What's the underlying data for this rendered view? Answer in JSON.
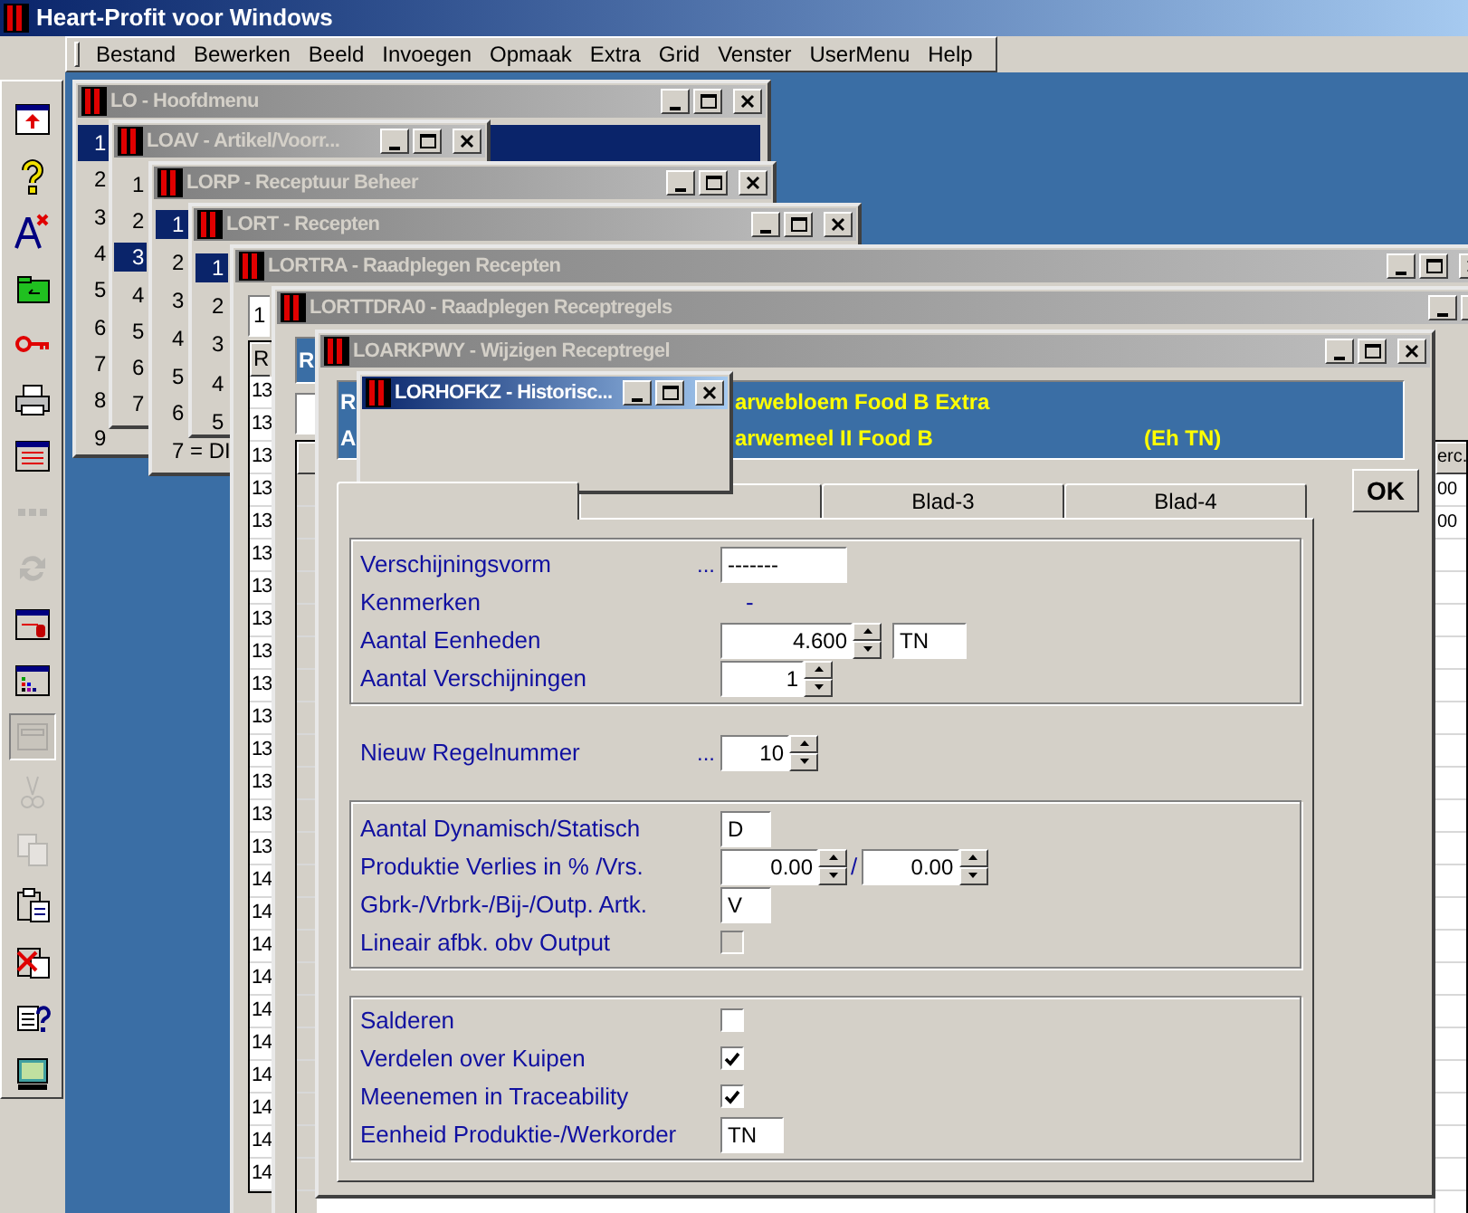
{
  "app": {
    "title": "Heart-Profit voor Windows"
  },
  "menu": [
    "Bestand",
    "Bewerken",
    "Beeld",
    "Invoegen",
    "Opmaak",
    "Extra",
    "Grid",
    "Venster",
    "UserMenu",
    "Help"
  ],
  "toolbar": [
    {
      "kind": "exit",
      "disabled": false,
      "pressed": false
    },
    {
      "kind": "help",
      "disabled": false,
      "pressed": false
    },
    {
      "kind": "font",
      "disabled": false,
      "pressed": false
    },
    {
      "kind": "folder",
      "disabled": false,
      "pressed": false
    },
    {
      "kind": "key",
      "disabled": false,
      "pressed": false
    },
    {
      "kind": "print",
      "disabled": false,
      "pressed": false
    },
    {
      "kind": "list",
      "disabled": false,
      "pressed": false
    },
    {
      "kind": "dots",
      "disabled": true,
      "pressed": false
    },
    {
      "kind": "refresh",
      "disabled": true,
      "pressed": false
    },
    {
      "kind": "mouse",
      "disabled": false,
      "pressed": false
    },
    {
      "kind": "chart",
      "disabled": false,
      "pressed": false
    },
    {
      "kind": "window",
      "disabled": true,
      "pressed": true
    },
    {
      "kind": "cut",
      "disabled": true,
      "pressed": false
    },
    {
      "kind": "copy",
      "disabled": true,
      "pressed": false
    },
    {
      "kind": "paste",
      "disabled": false,
      "pressed": false
    },
    {
      "kind": "paste_delete",
      "disabled": false,
      "pressed": false
    },
    {
      "kind": "doc_help",
      "disabled": false,
      "pressed": false
    },
    {
      "kind": "monitor",
      "disabled": false,
      "pressed": false
    }
  ],
  "lo_window": {
    "title": "LO - Hoofdmenu",
    "active": false,
    "items": [
      {
        "label": "1",
        "selected": true
      },
      {
        "label": "2",
        "selected": false
      },
      {
        "label": "3",
        "selected": false
      },
      {
        "label": "4",
        "selected": false
      },
      {
        "label": "5",
        "selected": false
      },
      {
        "label": "6",
        "selected": false
      },
      {
        "label": "7",
        "selected": false
      },
      {
        "label": "8",
        "selected": false
      },
      {
        "label": "9",
        "selected": false
      }
    ]
  },
  "loav_window": {
    "title": "LOAV - Artikel/Voorr...",
    "active": false,
    "items": [
      {
        "label": "1",
        "selected": false
      },
      {
        "label": "2",
        "selected": false
      },
      {
        "label": "3",
        "selected": true
      },
      {
        "label": "4",
        "selected": false
      },
      {
        "label": "5",
        "selected": false
      },
      {
        "label": "6",
        "selected": false
      },
      {
        "label": "7",
        "selected": false
      }
    ]
  },
  "lorp_window": {
    "title": "LORP - Receptuur Beheer",
    "active": false,
    "items": [
      {
        "label": "1",
        "selected": true
      },
      {
        "label": "2",
        "selected": false
      },
      {
        "label": "3",
        "selected": false
      },
      {
        "label": "4",
        "selected": false
      },
      {
        "label": "5",
        "selected": false
      },
      {
        "label": "6",
        "selected": false
      },
      {
        "label": "7 = DI",
        "selected": false
      }
    ]
  },
  "lort_window": {
    "title": "LORT - Recepten",
    "active": false,
    "items": [
      {
        "label": "1",
        "selected": true
      },
      {
        "label": "2",
        "selected": false
      },
      {
        "label": "3",
        "selected": false
      },
      {
        "label": "4",
        "selected": false
      },
      {
        "label": "5",
        "selected": false
      }
    ]
  },
  "lortra_window": {
    "title": "LORTRA - Raadplegen Recepten",
    "active": false,
    "field_value": "1",
    "grid": {
      "column_1": "R",
      "rows": [
        "13",
        "13",
        "13",
        "13",
        "13",
        "13",
        "13",
        "13",
        "13",
        "13",
        "13",
        "13",
        "13",
        "13",
        "13",
        "14",
        "14",
        "14",
        "14",
        "14",
        "14",
        "14",
        "14",
        "14",
        "14"
      ]
    }
  },
  "lorttdra0_window": {
    "title": "LORTTDRA0 - Raadplegen Receptregels",
    "active": false,
    "header_label": "R",
    "grid": {
      "column_2": "erc.",
      "rows": [
        {
          "column_2": "00"
        },
        {
          "column_2": "00"
        }
      ]
    }
  },
  "loarkpwy_window": {
    "title": "LOARKPWY - Wijzigen Receptregel",
    "active": false,
    "info": [
      {
        "label": "R",
        "value": "arwebloem Food B Extra"
      },
      {
        "label": "A",
        "value": "arwemeel II Food B",
        "unit": "(Eh TN)"
      }
    ],
    "tabs": [
      {
        "selected": true
      },
      {
        "selected": false
      },
      {
        "label": "Blad-3",
        "selected": false
      },
      {
        "label": "Blad-4",
        "selected": false
      }
    ],
    "ok_button": "OK",
    "groups": [
      {
        "bordered": true,
        "rows": [
          {
            "kind": "text",
            "label": "Verschijningsvorm",
            "prefix": "...",
            "value": "-------"
          },
          {
            "kind": "plain",
            "label": "Kenmerken",
            "value": "-"
          },
          {
            "kind": "spinner",
            "label": "Aantal Eenheden",
            "value": "4.600",
            "unit": "TN"
          },
          {
            "kind": "spinner",
            "label": "Aantal Verschijningen",
            "value": "1"
          }
        ]
      },
      {
        "bordered": false,
        "rows": [
          {
            "kind": "spinner",
            "label": "Nieuw Regelnummer",
            "prefix": "...",
            "value": "10"
          }
        ]
      },
      {
        "bordered": true,
        "rows": [
          {
            "kind": "text",
            "label": "Aantal Dynamisch/Statisch",
            "value": "D"
          },
          {
            "kind": "spinner_pair",
            "label": "Produktie Verlies in % /Vrs.",
            "values": [
              "0.00",
              "0.00"
            ],
            "separator": "/"
          },
          {
            "kind": "text",
            "label": "Gbrk-/Vrbrk-/Bij-/Outp. Artk.",
            "value": "V"
          },
          {
            "kind": "checkbox",
            "label": "Lineair afbk. obv Output",
            "checked": false,
            "disabled": true
          }
        ]
      },
      {
        "bordered": true,
        "rows": [
          {
            "kind": "checkbox",
            "label": "Salderen",
            "checked": false,
            "disabled": false
          },
          {
            "kind": "checkbox",
            "label": "Verdelen over Kuipen",
            "checked": true,
            "disabled": false
          },
          {
            "kind": "checkbox",
            "label": "Meenemen in Traceability",
            "checked": true,
            "disabled": false
          },
          {
            "kind": "text",
            "label": "Eenheid Produktie-/Werkorder",
            "value": "TN"
          }
        ]
      }
    ]
  },
  "lorhofkz_window": {
    "title": "LORHOFKZ - Historisc...",
    "active": true
  }
}
